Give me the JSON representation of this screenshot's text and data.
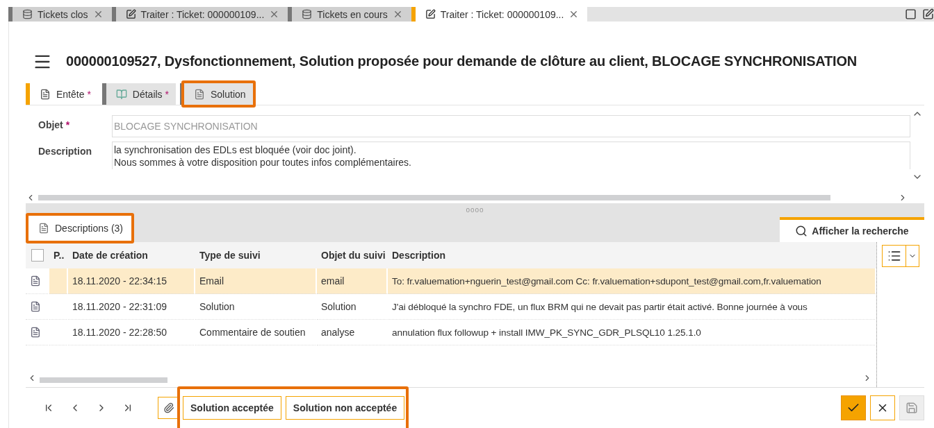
{
  "window_tabs": [
    {
      "kind": "list",
      "label": "Tickets clos",
      "selected": false
    },
    {
      "kind": "edit",
      "label": "Traiter : Ticket: 000000109...",
      "selected": false
    },
    {
      "kind": "list",
      "label": "Tickets en cours",
      "selected": false
    },
    {
      "kind": "edit",
      "label": "Traiter : Ticket: 000000109...",
      "selected": true
    }
  ],
  "title": "000000109527, Dysfonctionnement, Solution proposée pour demande de clôture au client, BLOCAGE SYNCHRONISATION",
  "form_tabs": [
    {
      "kind": "header",
      "label": "Entête",
      "required_mark": "*",
      "selected": true,
      "highlighted": false
    },
    {
      "kind": "book",
      "label": "Détails",
      "required_mark": "*",
      "selected": false,
      "highlighted": false
    },
    {
      "kind": "doc",
      "label": "Solution",
      "selected": false,
      "highlighted": true
    }
  ],
  "form": {
    "object_label": "Objet",
    "object_required": "*",
    "object_value": "BLOCAGE SYNCHRONISATION",
    "description_label": "Description",
    "description_lines": [
      "la synchronisation des EDLs est bloquée (voir doc joint).",
      "Nous sommes à votre disposition pour toutes infos complémentaires."
    ]
  },
  "splitter": "oooo",
  "descriptions_tab": {
    "label": "Descriptions (3)",
    "highlighted": true
  },
  "search_button": "Afficher la recherche",
  "table": {
    "select_all_checked": false,
    "columns": [
      "P..",
      "Date de création",
      "Type de suivi",
      "Objet du suivi",
      "Description"
    ],
    "rows": [
      {
        "selected": true,
        "cells": [
          "",
          "18.11.2020 - 22:34:15",
          "Email",
          "email",
          "To: fr.valuemation+nguerin_test@gmail.com Cc: fr.valuemation+sdupont_test@gmail.com,fr.valuemation"
        ]
      },
      {
        "selected": false,
        "cells": [
          "",
          "18.11.2020 - 22:31:09",
          "Solution",
          "Solution",
          "J'ai débloqué la synchro FDE, un flux BRM qui ne devait pas partir était activé.  Bonne journée à vous"
        ]
      },
      {
        "selected": false,
        "cells": [
          "",
          "18.11.2020 - 22:28:50",
          "Commentaire de soutien",
          "analyse",
          "annulation flux followup + install IMW_PK_SYNC_GDR_PLSQL10 1.25.1.0"
        ]
      }
    ]
  },
  "footer": {
    "action_buttons": [
      "Solution acceptée",
      "Solution non acceptée"
    ],
    "actions_highlighted": true
  }
}
